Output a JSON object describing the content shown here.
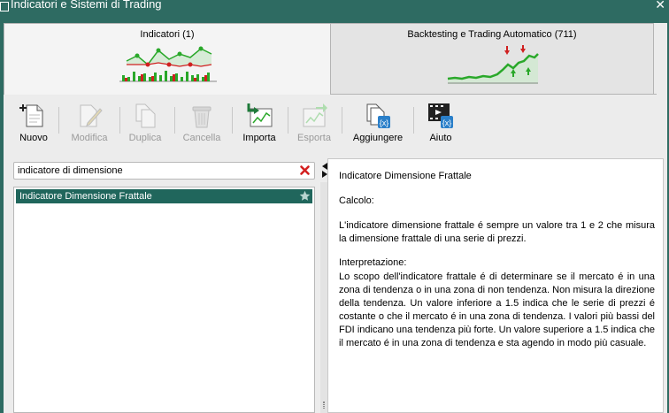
{
  "window": {
    "title": "Indicatori e Sistemi di Trading",
    "close_glyph": "✕"
  },
  "tabs": [
    {
      "label": "Indicatori (1)",
      "active": true,
      "icon": "indicator-chart-icon"
    },
    {
      "label": "Backtesting e Trading Automatico (711)",
      "active": false,
      "icon": "backtest-chart-icon"
    }
  ],
  "toolbar": {
    "buttons": [
      {
        "label": "Nuovo",
        "icon": "new-document-icon",
        "enabled": true
      },
      {
        "label": "Modifica",
        "icon": "edit-icon",
        "enabled": false
      },
      {
        "label": "Duplica",
        "icon": "duplicate-icon",
        "enabled": false
      },
      {
        "label": "Cancella",
        "icon": "trash-icon",
        "enabled": false
      },
      {
        "label": "Importa",
        "icon": "import-icon",
        "enabled": true
      },
      {
        "label": "Esporta",
        "icon": "export-icon",
        "enabled": false
      },
      {
        "label": "Aggiungere",
        "icon": "add-code-icon",
        "enabled": true
      },
      {
        "label": "Aiuto",
        "icon": "video-help-icon",
        "enabled": true
      }
    ]
  },
  "search": {
    "value": "indicatore di dimensione",
    "placeholder": ""
  },
  "list": {
    "items": [
      {
        "label": "Indicatore Dimensione Frattale",
        "selected": true
      }
    ]
  },
  "details": {
    "title": "Indicatore Dimensione Frattale",
    "calc_heading": "Calcolo:",
    "calc_text": "L'indicatore dimensione frattale é sempre un valore tra 1 e 2 che misura la dimensione frattale di una serie di prezzi.",
    "interp_heading": "Interpretazione:",
    "interp_text": "Lo scopo dell'indicatore frattale é di determinare se il mercato é in una zona di tendenza o in una zona di non tendenza. Non misura la direzione della tendenza. Un valore inferiore a 1.5 indica che le serie di prezzi é costante o che il mercato é in una zona di tendenza. I valori più bassi del FDI indicano una tendenza più forte. Un valore superiore a 1.5 indica che il mercato é in una zona di tendenza e sta agendo in modo più casuale."
  },
  "colors": {
    "accent": "#2e6b62",
    "selection": "#20665c",
    "chart_green": "#2aa82a",
    "chart_red": "#d02020",
    "clear_red": "#d32020"
  }
}
